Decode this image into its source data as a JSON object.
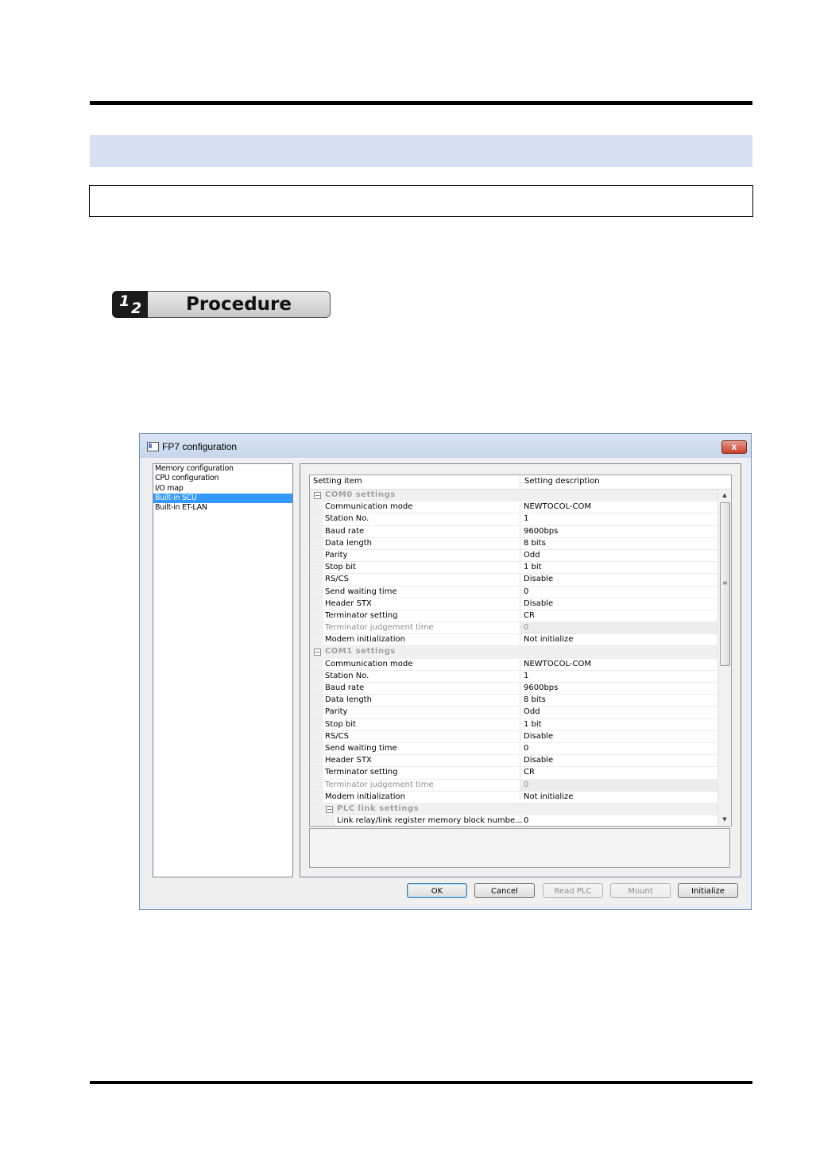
{
  "procedure": {
    "num1": "1",
    "num2": "2",
    "label": "Procedure"
  },
  "dialog": {
    "title": "FP7 configuration",
    "close_label": "x",
    "tree": [
      {
        "label": "Memory configuration",
        "selected": false
      },
      {
        "label": "CPU configuration",
        "selected": false
      },
      {
        "label": "I/O map",
        "selected": false
      },
      {
        "label": "Built-in SCU",
        "selected": true
      },
      {
        "label": "Built-in ET-LAN",
        "selected": false
      }
    ],
    "grid": {
      "col_item": "Setting item",
      "col_desc": "Setting description",
      "rows": [
        {
          "kind": "group",
          "label": "COM0 settings"
        },
        {
          "kind": "row",
          "item": "Communication mode",
          "value": "NEWTOCOL-COM"
        },
        {
          "kind": "row",
          "item": "Station No.",
          "value": "1"
        },
        {
          "kind": "row",
          "item": "Baud rate",
          "value": "9600bps"
        },
        {
          "kind": "row",
          "item": "Data length",
          "value": "8 bits"
        },
        {
          "kind": "row",
          "item": "Parity",
          "value": "Odd"
        },
        {
          "kind": "row",
          "item": "Stop bit",
          "value": "1 bit"
        },
        {
          "kind": "row",
          "item": "RS/CS",
          "value": "Disable"
        },
        {
          "kind": "row",
          "item": "Send waiting time",
          "value": "0"
        },
        {
          "kind": "row",
          "item": "Header STX",
          "value": "Disable"
        },
        {
          "kind": "row",
          "item": "Terminator setting",
          "value": "CR"
        },
        {
          "kind": "disabled",
          "item": "Terminator judgement time",
          "value": "0"
        },
        {
          "kind": "row",
          "item": "Modem initialization",
          "value": "Not initialize"
        },
        {
          "kind": "group",
          "label": "COM1 settings"
        },
        {
          "kind": "row",
          "item": "Communication mode",
          "value": "NEWTOCOL-COM"
        },
        {
          "kind": "row",
          "item": "Station No.",
          "value": "1"
        },
        {
          "kind": "row",
          "item": "Baud rate",
          "value": "9600bps"
        },
        {
          "kind": "row",
          "item": "Data length",
          "value": "8 bits"
        },
        {
          "kind": "row",
          "item": "Parity",
          "value": "Odd"
        },
        {
          "kind": "row",
          "item": "Stop bit",
          "value": "1 bit"
        },
        {
          "kind": "row",
          "item": "RS/CS",
          "value": "Disable"
        },
        {
          "kind": "row",
          "item": "Send waiting time",
          "value": "0"
        },
        {
          "kind": "row",
          "item": "Header STX",
          "value": "Disable"
        },
        {
          "kind": "row",
          "item": "Terminator setting",
          "value": "CR"
        },
        {
          "kind": "disabled",
          "item": "Terminator judgement time",
          "value": "0"
        },
        {
          "kind": "row",
          "item": "Modem initialization",
          "value": "Not initialize"
        },
        {
          "kind": "subgroup",
          "label": "PLC link settings"
        },
        {
          "kind": "subrow",
          "item": "Link relay/link register memory block numbe...",
          "value": "0"
        }
      ]
    },
    "buttons": {
      "ok": "OK",
      "cancel": "Cancel",
      "read_plc": "Read PLC",
      "mount": "Mount",
      "initialize": "Initialize"
    }
  }
}
